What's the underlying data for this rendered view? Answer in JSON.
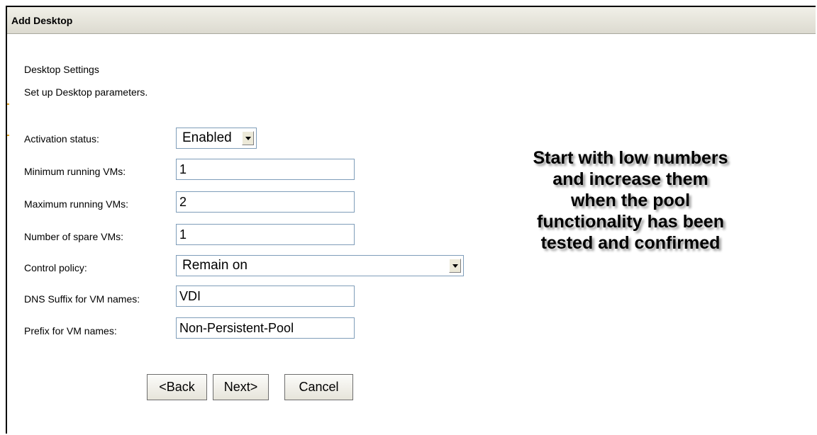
{
  "window": {
    "title": "Add Desktop"
  },
  "section": {
    "title": "Desktop Settings",
    "subtitle": "Set up Desktop parameters."
  },
  "form": {
    "activation_status": {
      "label": "Activation status:",
      "value": "Enabled"
    },
    "min_running_vms": {
      "label": "Minimum running VMs:",
      "value": "1"
    },
    "max_running_vms": {
      "label": "Maximum running VMs:",
      "value": "2"
    },
    "spare_vms": {
      "label": "Number of spare VMs:",
      "value": "1"
    },
    "control_policy": {
      "label": "Control policy:",
      "value": "Remain on"
    },
    "dns_suffix": {
      "label": "DNS Suffix for VM names:",
      "value": "VDI"
    },
    "vm_prefix": {
      "label": "Prefix for VM names:",
      "value": "Non-Persistent-Pool"
    }
  },
  "buttons": {
    "back": "<Back",
    "next": "Next>",
    "cancel": "Cancel"
  },
  "annotation": {
    "lines": [
      "Start with low numbers",
      "and increase them",
      "when the pool",
      "functionality has been",
      "tested and confirmed"
    ]
  },
  "colors": {
    "titlebar": "#dcdad0",
    "field_border": "#7f9db9"
  }
}
